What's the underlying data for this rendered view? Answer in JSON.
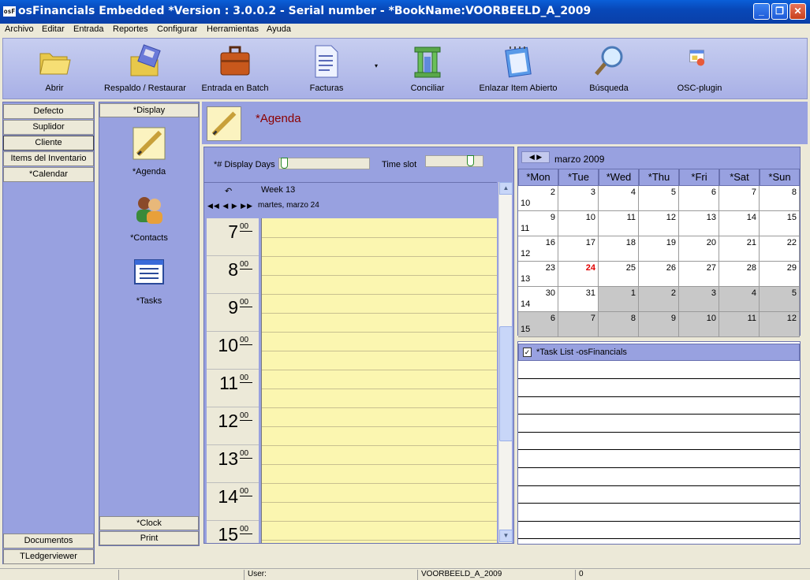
{
  "window": {
    "app_icon": "osF",
    "title": "osFinancials Embedded *Version : 3.0.0.2 -  Serial number - *BookName:VOORBEELD_A_2009",
    "minimize": "_",
    "maximize": "❐",
    "close": "✕"
  },
  "menu": [
    "Archivo",
    "Editar",
    "Entrada",
    "Reportes",
    "Configurar",
    "Herramientas",
    "Ayuda"
  ],
  "toolbar": {
    "items": [
      {
        "label": "Abrir",
        "icon": "folder-icon"
      },
      {
        "label": "Respaldo / Restaurar",
        "icon": "backup-restore-icon"
      },
      {
        "label": "Entrada en Batch",
        "icon": "briefcase-icon"
      },
      {
        "label": "Facturas",
        "icon": "document-icon"
      },
      {
        "label": "Conciliar",
        "icon": "column-chart-icon"
      },
      {
        "label": "Enlazar Item Abierto",
        "icon": "notepad-icon"
      },
      {
        "label": "Búsqueda",
        "icon": "magnifier-icon"
      },
      {
        "label": "OSC-plugin",
        "icon": "plugin-icon"
      }
    ],
    "dropdown_arrow": "▾"
  },
  "leftnav": {
    "top": [
      "Defecto",
      "Suplidor",
      "Cliente",
      "Items del Inventario",
      "*Calendar"
    ],
    "bottom": [
      "Documentos",
      "TLedgerviewer"
    ]
  },
  "panel2": {
    "header": "*Display",
    "items": [
      {
        "label": "*Agenda",
        "icon": "agenda-pencil-icon"
      },
      {
        "label": "*Contacts",
        "icon": "contacts-icon"
      },
      {
        "label": "*Tasks",
        "icon": "tasks-window-icon"
      }
    ],
    "bottom": [
      "*Clock",
      "Print"
    ]
  },
  "agenda": {
    "title": "*Agenda",
    "display_days_label": "*# Display Days",
    "time_slot_label": "Time slot",
    "week_label": "Week  13",
    "date_label": "martes, marzo 24",
    "undo_glyph": "↶",
    "nav_arrows": "◀◀ ◀ ▶ ▶▶",
    "hours": [
      "7",
      "8",
      "9",
      "10",
      "11",
      "12",
      "13",
      "14",
      "15"
    ],
    "minutes": "00",
    "scroll_up": "▲",
    "scroll_down": "▼"
  },
  "calendar": {
    "nav": "◀  ▶",
    "month": "marzo 2009",
    "days_of_week": [
      "*Mon",
      "*Tue",
      "*Wed",
      "*Thu",
      "*Fri",
      "*Sat",
      "*Sun"
    ],
    "weeks": [
      {
        "wk": "10",
        "days": [
          "2",
          "3",
          "4",
          "5",
          "6",
          "7",
          "8"
        ]
      },
      {
        "wk": "11",
        "days": [
          "9",
          "10",
          "11",
          "12",
          "13",
          "14",
          "15"
        ]
      },
      {
        "wk": "12",
        "days": [
          "16",
          "17",
          "18",
          "19",
          "20",
          "21",
          "22"
        ]
      },
      {
        "wk": "13",
        "days": [
          "23",
          "24",
          "25",
          "26",
          "27",
          "28",
          "29"
        ]
      },
      {
        "wk": "14",
        "days": [
          "30",
          "31",
          "1",
          "2",
          "3",
          "4",
          "5"
        ]
      },
      {
        "wk": "15",
        "days": [
          "6",
          "7",
          "8",
          "9",
          "10",
          "11",
          "12"
        ]
      }
    ],
    "today": "24",
    "today_color": "#e00000"
  },
  "tasklist": {
    "title": "*Task List -osFinancials",
    "check": "✓"
  },
  "status": {
    "user": "User:",
    "book": "VOORBEELD_A_2009",
    "count": "0"
  },
  "colors": {
    "panel": "#98a1e0",
    "agenda_bg": "#fbf6b0",
    "title_bar": "#0848b8"
  }
}
